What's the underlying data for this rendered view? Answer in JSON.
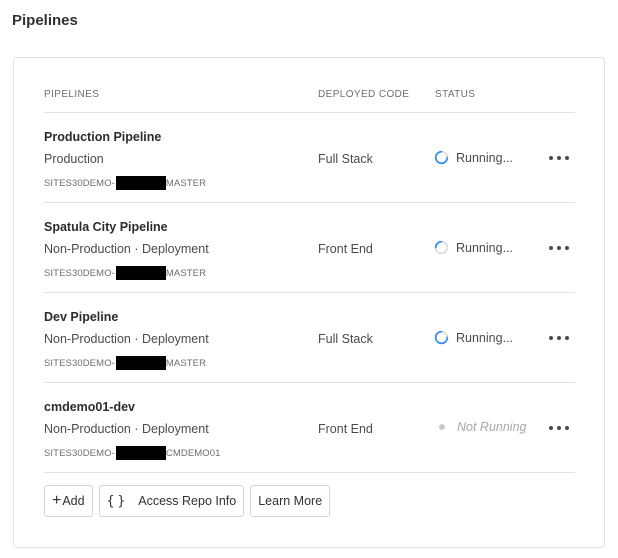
{
  "page": {
    "title": "Pipelines"
  },
  "table": {
    "headers": {
      "pipelines": "PIPELINES",
      "deployed_code": "DEPLOYED CODE",
      "status": "STATUS"
    },
    "rows": [
      {
        "name": "Production Pipeline",
        "environment": "Production",
        "repo_prefix": "SITES30DEMO-",
        "repo_suffix": "MASTER",
        "deployed_code": "Full Stack",
        "status": "Running...",
        "status_icon": "spinner-icon"
      },
      {
        "name": "Spatula City Pipeline",
        "environment": "Non-Production · Deployment",
        "repo_prefix": "SITES30DEMO-",
        "repo_suffix": "MASTER",
        "deployed_code": "Front End",
        "status": "Running...",
        "status_icon": "spinner-icon"
      },
      {
        "name": "Dev Pipeline",
        "environment": "Non-Production · Deployment",
        "repo_prefix": "SITES30DEMO-",
        "repo_suffix": "MASTER",
        "deployed_code": "Full Stack",
        "status": "Running...",
        "status_icon": "spinner-icon"
      },
      {
        "name": "cmdemo01-dev",
        "environment": "Non-Production · Deployment",
        "repo_prefix": "SITES30DEMO-",
        "repo_suffix": "CMDEMO01",
        "deployed_code": "Front End",
        "status": "Not Running",
        "status_icon": "dot-icon"
      }
    ]
  },
  "actions": {
    "add_label": "Add",
    "access_repo_label": "Access Repo Info",
    "learn_more_label": "Learn More"
  },
  "colors": {
    "spinner": "#378ef0",
    "border": "#e1e1e1",
    "muted": "#a8a8a8"
  }
}
